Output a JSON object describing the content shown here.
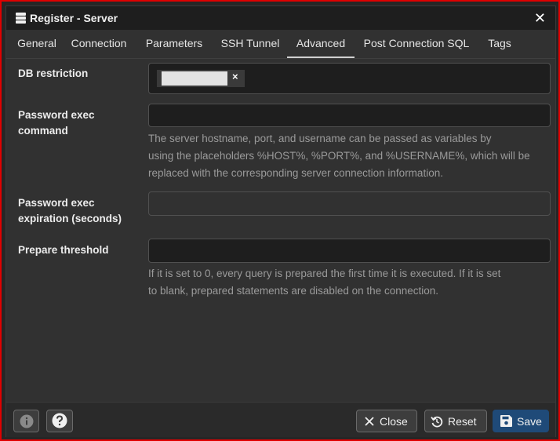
{
  "window": {
    "title": "Register - Server",
    "icon": "server-icon",
    "close_glyph": "✕"
  },
  "tabs": [
    {
      "label": "General"
    },
    {
      "label": "Connection"
    },
    {
      "label": "Parameters"
    },
    {
      "label": "SSH Tunnel"
    },
    {
      "label": "Advanced",
      "active": true
    },
    {
      "label": "Post Connection SQL"
    },
    {
      "label": "Tags"
    }
  ],
  "form": {
    "db_restriction": {
      "label": "DB restriction",
      "chip_remove": "×"
    },
    "password_exec_command": {
      "label_line1": "Password exec",
      "label_line2": "command",
      "value": "",
      "help_line1": "The server hostname, port, and username can be passed as variables by",
      "help_line2": "using the placeholders %HOST%, %PORT%, and %USERNAME%, which will be",
      "help_line3": "replaced with the corresponding server connection information."
    },
    "password_exec_expiration": {
      "label_line1": "Password exec",
      "label_line2": "expiration (seconds)",
      "value": ""
    },
    "prepare_threshold": {
      "label": "Prepare threshold",
      "value": "",
      "help_line1": "If it is set to 0, every query is prepared the first time it is executed. If it is set",
      "help_line2": "to blank, prepared statements are disabled on the connection."
    }
  },
  "footer": {
    "info_icon": "info-icon",
    "help_icon": "question-icon",
    "close_label": "Close",
    "reset_label": "Reset",
    "save_label": "Save"
  },
  "colors": {
    "accent": "#1f4a78",
    "frame": "#e00000",
    "background": "#313131"
  }
}
